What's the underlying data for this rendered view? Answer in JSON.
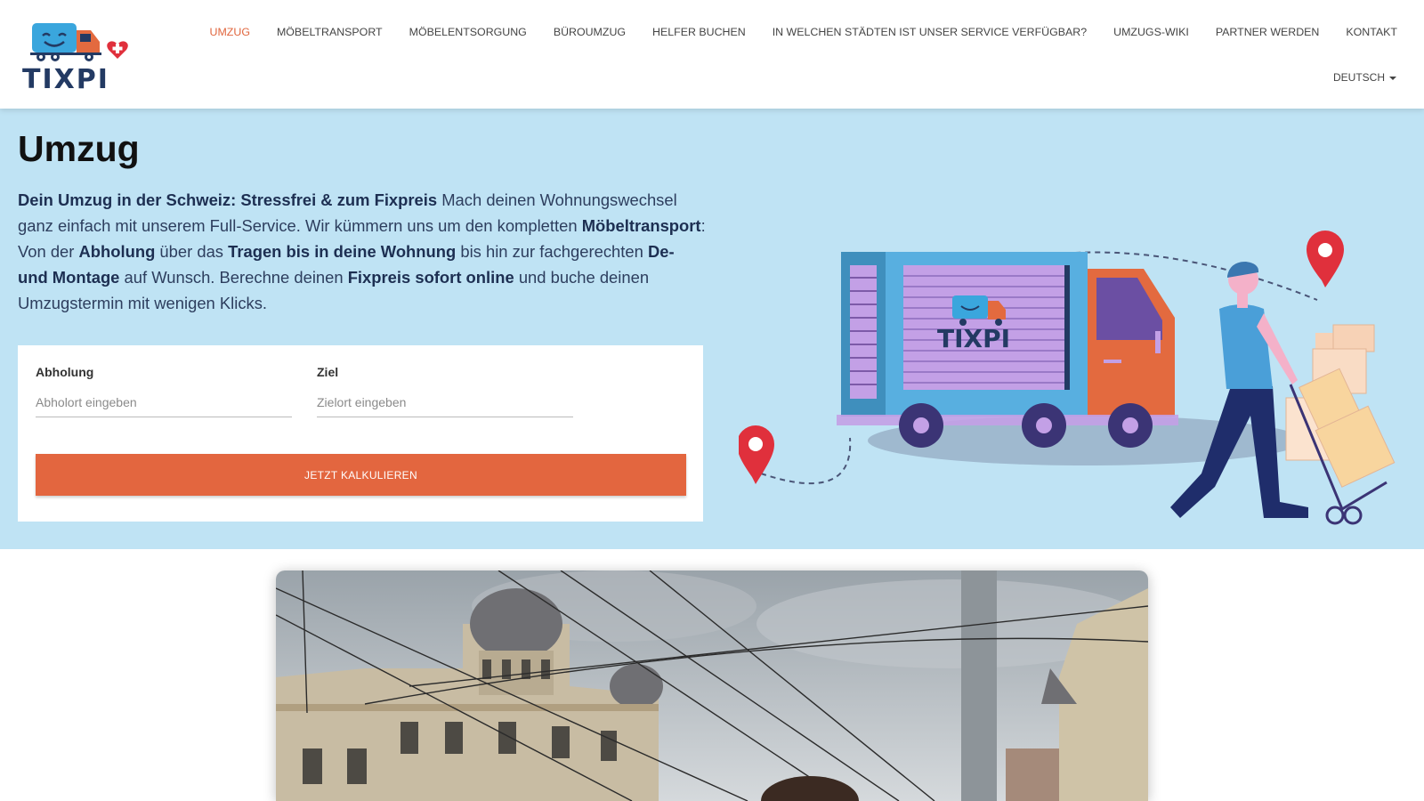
{
  "brand": {
    "name": "TIXPI",
    "accent": "#e0663e",
    "dark": "#233a63",
    "hero_bg": "#bfe3f4"
  },
  "nav": {
    "items": [
      {
        "label": "UMZUG",
        "active": true
      },
      {
        "label": "MÖBELTRANSPORT"
      },
      {
        "label": "MÖBELENTSORGUNG"
      },
      {
        "label": "BÜROUMZUG"
      },
      {
        "label": "HELFER BUCHEN"
      },
      {
        "label": "IN WELCHEN STÄDTEN IST UNSER SERVICE VERFÜGBAR?"
      },
      {
        "label": "UMZUGS-WIKI"
      },
      {
        "label": "PARTNER WERDEN"
      },
      {
        "label": "KONTAKT"
      }
    ],
    "language": "DEUTSCH"
  },
  "hero": {
    "title": "Umzug",
    "intro": {
      "b1": "Dein Umzug in der Schweiz: Stressfrei & zum Fixpreis",
      "t1": " Mach deinen Wohnungswechsel ganz einfach mit unserem Full-Service. Wir kümmern uns um den kompletten ",
      "b2": "Möbeltransport",
      "t2": ": Von der ",
      "b3": "Abholung",
      "t3": " über das ",
      "b4": "Tragen bis in deine Wohnung",
      "t4": " bis hin zur fachgerechten ",
      "b5": "De- und Montage",
      "t5": " auf Wunsch. Berechne deinen ",
      "b6": "Fixpreis sofort online",
      "t6": " und buche deinen Umzugstermin mit wenigen Klicks."
    },
    "form": {
      "pickup_label": "Abholung",
      "pickup_placeholder": "Abholort eingeben",
      "pickup_value": "",
      "dest_label": "Ziel",
      "dest_placeholder": "Zielort eingeben",
      "dest_value": "",
      "submit_label": "JETZT KALKULIEREN"
    },
    "illustration": {
      "truck_label": "TIXPI",
      "icons": [
        "location-pin-icon",
        "truck-icon",
        "mover-person",
        "hand-truck-boxes"
      ]
    }
  },
  "photo": {
    "subject": "street-photo-tram-wires-building"
  }
}
